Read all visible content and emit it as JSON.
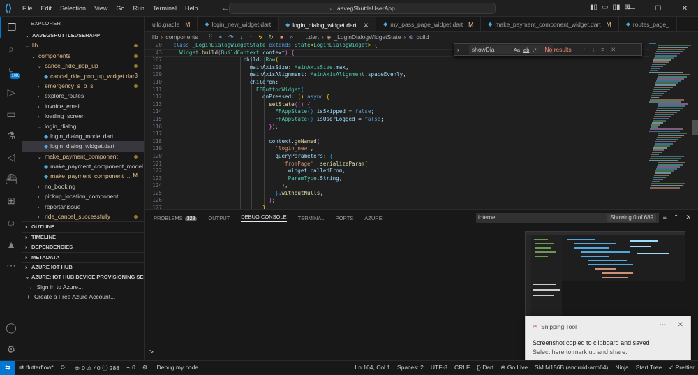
{
  "titlebar": {
    "menu": [
      "File",
      "Edit",
      "Selection",
      "View",
      "Go",
      "Run",
      "Terminal",
      "Help"
    ],
    "command_center": "aavegShuttleUserApp"
  },
  "activity": {
    "extensions_badge": "10K"
  },
  "explorer": {
    "header": "EXPLORER",
    "root": "AAVEGSHUTTLEUSERAPP",
    "tree": [
      {
        "label": "lib",
        "indent": 0,
        "folder": true,
        "open": true,
        "color": "yellow",
        "dot": true
      },
      {
        "label": "components",
        "indent": 1,
        "folder": true,
        "open": true,
        "color": "yellow",
        "dot": true
      },
      {
        "label": "cancel_ride_pop_up",
        "indent": 2,
        "folder": true,
        "open": true,
        "color": "yellow",
        "dot": true
      },
      {
        "label": "cancel_ride_pop_up_widget.dart",
        "indent": 3,
        "folder": false,
        "color": "yellow",
        "mark": "3"
      },
      {
        "label": "emergency_s_o_s",
        "indent": 2,
        "folder": true,
        "open": false,
        "color": "yellow",
        "dot": true
      },
      {
        "label": "explore_routes",
        "indent": 2,
        "folder": true,
        "open": false,
        "color": "plain"
      },
      {
        "label": "invoice_email",
        "indent": 2,
        "folder": true,
        "open": false,
        "color": "plain"
      },
      {
        "label": "loading_screen",
        "indent": 2,
        "folder": true,
        "open": false,
        "color": "plain"
      },
      {
        "label": "login_dialog",
        "indent": 2,
        "folder": true,
        "open": true,
        "color": "plain"
      },
      {
        "label": "login_dialog_model.dart",
        "indent": 3,
        "folder": false,
        "color": "plain"
      },
      {
        "label": "login_dialog_widget.dart",
        "indent": 3,
        "folder": false,
        "color": "plain",
        "selected": true
      },
      {
        "label": "make_payment_component",
        "indent": 2,
        "folder": true,
        "open": true,
        "color": "yellow",
        "dot": true
      },
      {
        "label": "make_payment_component_model...",
        "indent": 3,
        "folder": false,
        "color": "plain"
      },
      {
        "label": "make_payment_component_...",
        "indent": 3,
        "folder": false,
        "color": "yellow",
        "mark": "M"
      },
      {
        "label": "no_booking",
        "indent": 2,
        "folder": true,
        "open": false,
        "color": "plain"
      },
      {
        "label": "pickup_location_component",
        "indent": 2,
        "folder": true,
        "open": false,
        "color": "plain"
      },
      {
        "label": "reportanissue",
        "indent": 2,
        "folder": true,
        "open": false,
        "color": "plain"
      },
      {
        "label": "ride_cancel_successfully",
        "indent": 2,
        "folder": true,
        "open": false,
        "color": "yellow",
        "dot": true
      }
    ],
    "sections": [
      "OUTLINE",
      "TIMELINE",
      "DEPENDENCIES",
      "METADATA",
      "AZURE IOT HUB",
      "AZURE: IOT HUB DEVICE PROVISIONING SERV..."
    ],
    "azure_items": [
      {
        "icon": "→",
        "label": "Sign in to Azure..."
      },
      {
        "icon": "+",
        "label": "Create a Free Azure Account..."
      }
    ]
  },
  "tabs": [
    {
      "label": "uild.gradle",
      "mod": "M",
      "active": false
    },
    {
      "label": "login_new_widget.dart",
      "mod": "",
      "active": false
    },
    {
      "label": "login_dialog_widget.dart",
      "mod": "",
      "active": true
    },
    {
      "label": "my_pass_page_widget.dart",
      "mod": "M",
      "active": false
    },
    {
      "label": "make_payment_component_widget.dart",
      "mod": "M",
      "active": false
    },
    {
      "label": "routes_page_",
      "mod": "",
      "active": false
    }
  ],
  "breadcrumb": {
    "parts": [
      "lib",
      "components"
    ],
    "tail_parts": [
      "t.dart",
      "_LoginDialogWidgetState",
      "build"
    ]
  },
  "find": {
    "query": "showDia",
    "result": "No results"
  },
  "code": {
    "sticky": [
      {
        "n": "20",
        "html": "<span class=\"kw\">class</span> <span class=\"cls\">_LoginDialogWidgetState</span> <span class=\"kw\">extends</span> <span class=\"cls\">State</span><span class=\"br1\">&lt;</span><span class=\"cls\">LoginDialogWidget</span><span class=\"br1\">&gt;</span> <span class=\"br1\">{</span>"
      },
      {
        "n": "43",
        "html": "  <span class=\"cls\">Widget</span> <span class=\"fn\">build</span><span class=\"br2\">(</span><span class=\"cls\">BuildContext</span> <span class=\"prop\">context</span><span class=\"br2\">)</span> <span class=\"br2\">{</span>"
      }
    ],
    "lines": [
      {
        "n": "107",
        "html": "                      <span class=\"prop\">child</span>: <span class=\"cls\">Row</span><span class=\"br1\">(</span>"
      },
      {
        "n": "108",
        "html": "                        <span class=\"prop\">mainAxisSize</span>: <span class=\"cls\">MainAxisSize</span>.<span class=\"prop\">max</span>,"
      },
      {
        "n": "109",
        "html": "                        <span class=\"prop\">mainAxisAlignment</span>: <span class=\"cls\">MainAxisAlignment</span>.<span class=\"prop\">spaceEvenly</span>,"
      },
      {
        "n": "110",
        "html": "                        <span class=\"prop\">children</span>: <span class=\"br2\">[</span>"
      },
      {
        "n": "111",
        "html": "                          <span class=\"cls\">FFButtonWidget</span><span class=\"br3\">(</span>"
      },
      {
        "n": "112",
        "html": "                            <span class=\"prop\">onPressed</span>: <span class=\"br1\">()</span> <span class=\"kw\">async</span> <span class=\"br1\">{</span>"
      },
      {
        "n": "113",
        "html": "                              <span class=\"fn\">setState</span><span class=\"br2\">(()</span> <span class=\"br2\">{</span>"
      },
      {
        "n": "114",
        "html": "                                <span class=\"cls\">FFAppState</span><span class=\"br3\">()</span>.<span class=\"prop\">isSkipped</span> = <span class=\"kw\">false</span>;"
      },
      {
        "n": "115",
        "html": "                                <span class=\"cls\">FFAppState</span><span class=\"br3\">()</span>.<span class=\"prop\">isUserLogged</span> = <span class=\"kw\">false</span>;"
      },
      {
        "n": "116",
        "html": "                              <span class=\"br2\">})</span>;"
      },
      {
        "n": "117",
        "html": ""
      },
      {
        "n": "118",
        "html": "                              <span class=\"prop\">context</span>.<span class=\"fn\">goNamed</span><span class=\"br2\">(</span>"
      },
      {
        "n": "119",
        "html": "                                <span class=\"str\">'login_new'</span>,"
      },
      {
        "n": "120",
        "html": "                                <span class=\"prop\">queryParameters</span>: <span class=\"br3\">{</span>"
      },
      {
        "n": "121",
        "html": "                                  <span class=\"str\">'fromPage'</span>: <span class=\"fn\">serializeParam</span><span class=\"br1\">(</span>"
      },
      {
        "n": "122",
        "html": "                                    <span class=\"prop\">widget</span>.<span class=\"prop\">calledFrom</span>,"
      },
      {
        "n": "123",
        "html": "                                    <span class=\"cls\">ParamType</span>.<span class=\"prop\">String</span>,"
      },
      {
        "n": "124",
        "html": "                                  <span class=\"br1\">)</span>,"
      },
      {
        "n": "125",
        "html": "                                <span class=\"br3\">}</span>.<span class=\"fn\">withoutNulls</span>,"
      },
      {
        "n": "126",
        "html": "                              <span class=\"br2\">)</span>;"
      },
      {
        "n": "127",
        "html": "                            <span class=\"br1\">}</span>,"
      }
    ]
  },
  "panel": {
    "tabs": [
      {
        "label": "PROBLEMS",
        "badge": "328",
        "active": false
      },
      {
        "label": "OUTPUT",
        "badge": "",
        "active": false
      },
      {
        "label": "DEBUG CONSOLE",
        "badge": "",
        "active": true
      },
      {
        "label": "TERMINAL",
        "badge": "",
        "active": false
      },
      {
        "label": "PORTS",
        "badge": "",
        "active": false
      },
      {
        "label": "AZURE",
        "badge": "",
        "active": false
      }
    ],
    "filter_value": "internet",
    "showing": "Showing 0 of 689",
    "prompt": ">"
  },
  "toast": {
    "app": "Snipping Tool",
    "line1": "Screenshot copied to clipboard and saved",
    "line2": "Select here to mark up and share."
  },
  "status": {
    "left": [
      {
        "icon": "⇄",
        "label": "flutterflow*"
      },
      {
        "icon": "⟳",
        "label": ""
      },
      {
        "icon": "⊗",
        "label": "0 ⚠ 40 ⓘ 288"
      },
      {
        "icon": "⌁",
        "label": "0"
      },
      {
        "icon": "⚙",
        "label": ""
      },
      {
        "icon": "",
        "label": "Debug my code"
      }
    ],
    "right": [
      "Ln 164, Col 1",
      "Spaces: 2",
      "UTF-8",
      "CRLF",
      "{} Dart",
      "⊕ Go Live",
      "SM M156B (android-arm64)",
      "Ninja",
      "Start Tree",
      "✓ Prettier"
    ]
  },
  "colors": {
    "accent": "#0078d4",
    "modified": "#e2c08d",
    "error": "#f48771"
  }
}
